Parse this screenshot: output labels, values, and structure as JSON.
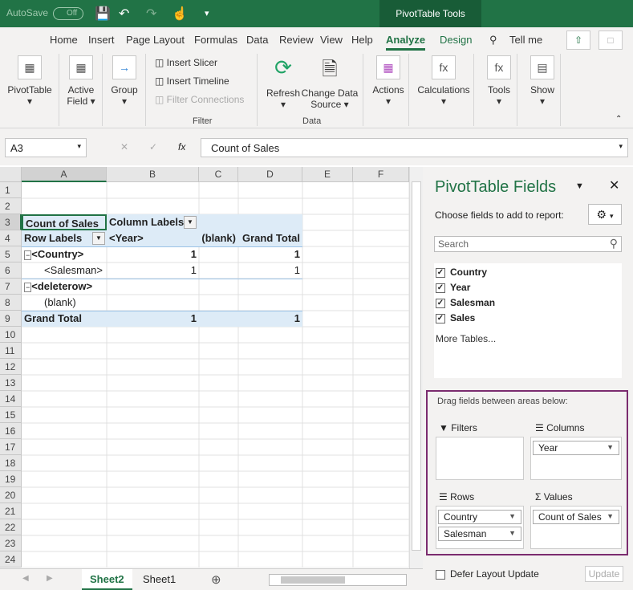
{
  "titlebar": {
    "autosave": "AutoSave",
    "autosave_state": "Off",
    "context": "PivotTable Tools"
  },
  "tabs": [
    "Home",
    "Insert",
    "Page Layout",
    "Formulas",
    "Data",
    "Review",
    "View",
    "Help",
    "Analyze",
    "Design"
  ],
  "tell_me": "Tell me",
  "ribbon": {
    "pivottable": "PivotTable",
    "active_field": "Active",
    "active_field2": "Field",
    "group": "Group",
    "insert_slicer": "Insert Slicer",
    "insert_timeline": "Insert Timeline",
    "filter_connections": "Filter Connections",
    "filter_group": "Filter",
    "refresh": "Refresh",
    "change_data": "Change Data",
    "source": "Source",
    "data_group": "Data",
    "actions": "Actions",
    "calculations": "Calculations",
    "tools": "Tools",
    "show": "Show"
  },
  "formula": {
    "namebox": "A3",
    "fx": "fx",
    "value": "Count of Sales"
  },
  "columns": [
    "A",
    "B",
    "C",
    "D",
    "E",
    "F"
  ],
  "rows": [
    "1",
    "2",
    "3",
    "4",
    "5",
    "6",
    "7",
    "8",
    "9",
    "10",
    "11",
    "12",
    "13",
    "14",
    "15",
    "16",
    "17",
    "18",
    "19",
    "20",
    "21",
    "22",
    "23",
    "24"
  ],
  "pivot": {
    "r3a": "Count of Sales",
    "r3b": "Column Labels",
    "r4a": "Row Labels",
    "r4b": "<Year>",
    "r4c": "(blank)",
    "r4d": "Grand Total",
    "r5a": "<Country>",
    "r5c": "1",
    "r5d": "1",
    "r6a": "<Salesman>",
    "r6c": "1",
    "r6d": "1",
    "r7a": "<deleterow>",
    "r8a": "(blank)",
    "r9a": "Grand Total",
    "r9c": "1",
    "r9d": "1"
  },
  "sheets": [
    "Sheet2",
    "Sheet1"
  ],
  "pane": {
    "title": "PivotTable Fields",
    "choose": "Choose fields to add to report:",
    "search_placeholder": "Search",
    "fields": [
      "Country",
      "Year",
      "Salesman",
      "Sales"
    ],
    "more": "More Tables...",
    "drag": "Drag fields between areas below:",
    "filters": "Filters",
    "columns": "Columns",
    "rows": "Rows",
    "values": "Values",
    "col_items": [
      "Year"
    ],
    "row_items": [
      "Country",
      "Salesman"
    ],
    "val_items": [
      "Count of Sales"
    ],
    "defer": "Defer Layout Update",
    "update": "Update",
    "accent": "#7b2c6f"
  }
}
